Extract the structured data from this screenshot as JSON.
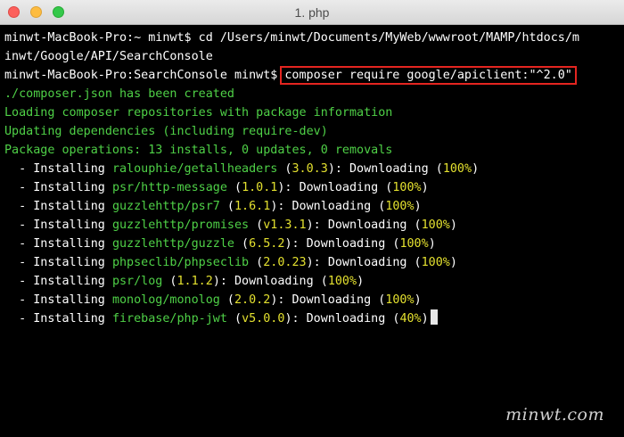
{
  "window": {
    "title": "1. php"
  },
  "terminal": {
    "line1": "minwt-MacBook-Pro:~ minwt$ cd /Users/minwt/Documents/MyWeb/wwwroot/MAMP/htdocs/m",
    "line2": "inwt/Google/API/SearchConsole",
    "prompt3": "minwt-MacBook-Pro:SearchConsole minwt$",
    "command3": "composer require google/apiclient:\"^2.0\"",
    "line4": "./composer.json has been created",
    "line5": "Loading composer repositories with package information",
    "line6": "Updating dependencies (including require-dev)",
    "line7": "Package operations: 13 installs, 0 updates, 0 removals",
    "installs": [
      {
        "prefix": "  - Installing ",
        "pkg": "ralouphie/getallheaders",
        "version": "3.0.3",
        "pct": "100%"
      },
      {
        "prefix": "  - Installing ",
        "pkg": "psr/http-message",
        "version": "1.0.1",
        "pct": "100%"
      },
      {
        "prefix": "  - Installing ",
        "pkg": "guzzlehttp/psr7",
        "version": "1.6.1",
        "pct": "100%"
      },
      {
        "prefix": "  - Installing ",
        "pkg": "guzzlehttp/promises",
        "version": "v1.3.1",
        "pct": "100%"
      },
      {
        "prefix": "  - Installing ",
        "pkg": "guzzlehttp/guzzle",
        "version": "6.5.2",
        "pct": "100%"
      },
      {
        "prefix": "  - Installing ",
        "pkg": "phpseclib/phpseclib",
        "version": "2.0.23",
        "pct": "100%"
      },
      {
        "prefix": "  - Installing ",
        "pkg": "psr/log",
        "version": "1.1.2",
        "pct": "100%"
      },
      {
        "prefix": "  - Installing ",
        "pkg": "monolog/monolog",
        "version": "2.0.2",
        "pct": "100%"
      },
      {
        "prefix": "  - Installing ",
        "pkg": "firebase/php-jwt",
        "version": "v5.0.0",
        "pct": "40%"
      }
    ],
    "downloading_label": "Downloading"
  },
  "watermark": "minwt.com",
  "colors": {
    "green": "#4fd147",
    "yellow": "#e3e02f",
    "highlight_border": "#e42520"
  }
}
